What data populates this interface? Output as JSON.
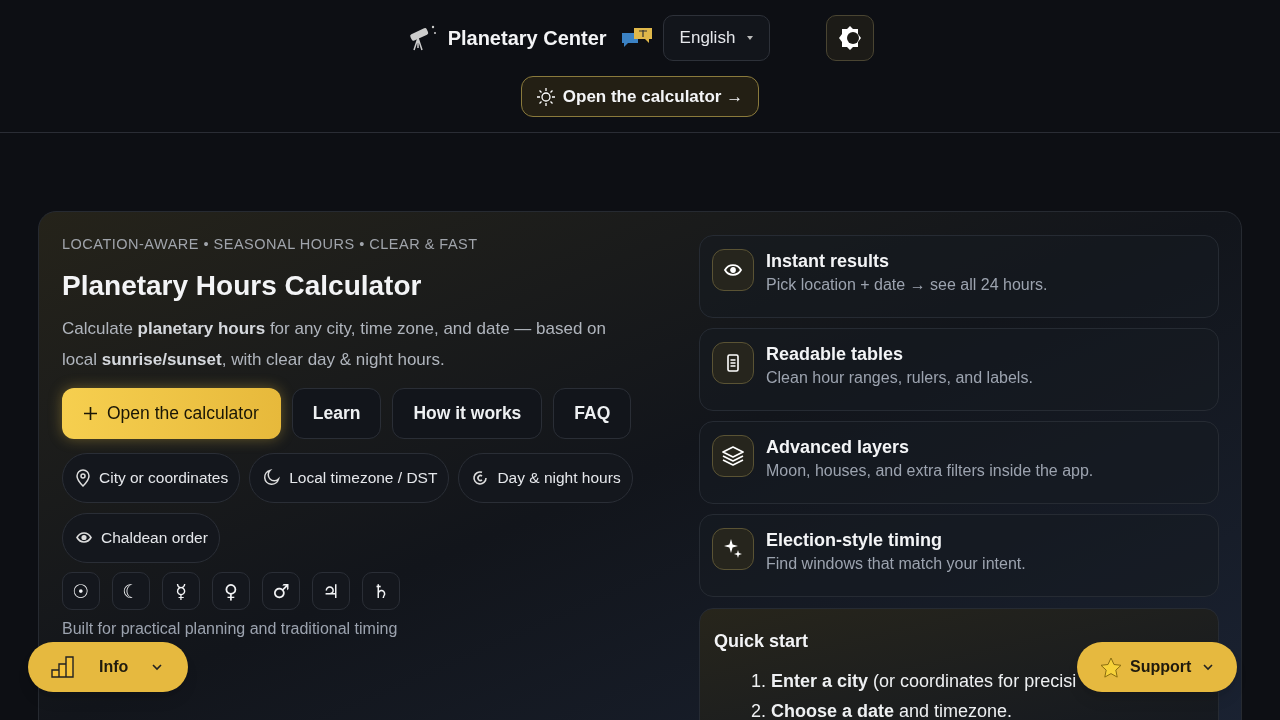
{
  "header": {
    "brand": "Planetary Center",
    "language": "English",
    "cta": "Open the calculator →"
  },
  "hero": {
    "eyebrow": "LOCATION-AWARE • SEASONAL HOURS • CLEAR & FAST",
    "title": "Planetary Hours Calculator",
    "lead": "Calculate **planetary hours** for any city, time zone, and date — based on local **sunrise/sunset**, with clear day & night hours.",
    "buttons": [
      {
        "label": "Open the calculator",
        "kind": "primary"
      },
      {
        "label": "Learn",
        "kind": "secondary"
      },
      {
        "label": "How it works",
        "kind": "secondary"
      },
      {
        "label": "FAQ",
        "kind": "secondary"
      }
    ],
    "features": [
      {
        "label": "City or coordinates",
        "kind": "pin"
      },
      {
        "label": "Local timezone / DST",
        "kind": "moon"
      },
      {
        "label": "Day & night hours",
        "kind": "cycle"
      },
      {
        "label": "Chaldean order",
        "kind": "eye"
      }
    ],
    "planets": [
      "☉",
      "☾",
      "☿",
      "♀",
      "♂",
      "♃",
      "♄"
    ],
    "note": "Built for practical planning and traditional timing"
  },
  "cards": [
    {
      "kind": "eye",
      "title": "Instant results",
      "text": "Pick location + date → see all 24 hours."
    },
    {
      "kind": "table",
      "title": "Readable tables",
      "text": "Clean hour ranges, rulers, and labels."
    },
    {
      "kind": "layers",
      "title": "Advanced layers",
      "text": "Moon, houses, and extra filters inside the app."
    },
    {
      "kind": "sparkle",
      "title": "Election-style timing",
      "text": "Find windows that match your intent."
    }
  ],
  "quick_start": {
    "title": "Quick start",
    "steps": [
      {
        "number": "1.",
        "text": "**Enter a city** (or coordinates for precisi"
      },
      {
        "number": "2.",
        "text": "**Choose a date** and timezone."
      }
    ]
  },
  "floating": {
    "info": "Info",
    "support": "Support"
  }
}
